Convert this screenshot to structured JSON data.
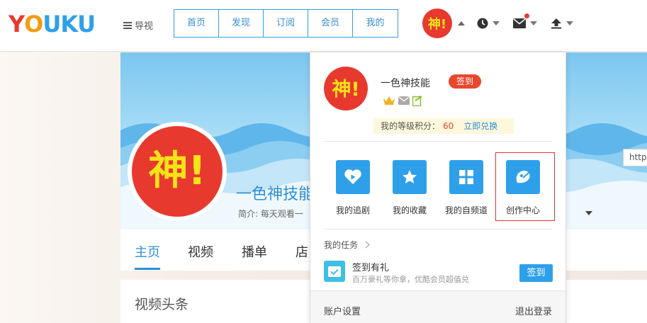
{
  "header": {
    "logo_letters": [
      "Y",
      "O",
      "U",
      "K",
      "U"
    ],
    "logo_colors": [
      "#e8392e",
      "#f39c12",
      "#2ea0ea",
      "#2ea0ea",
      "#2ea0ea"
    ],
    "guide_label": "导视",
    "tabs": [
      "首页",
      "发现",
      "订阅",
      "会员",
      "我的"
    ],
    "icons": [
      "history-clock-icon",
      "message-envelope-icon",
      "upload-icon"
    ]
  },
  "avatar_text": "神!",
  "profile": {
    "name": "一色神技能",
    "intro": "简介: 每天观看一",
    "tooltip": "http",
    "nav": [
      "主页",
      "视频",
      "播单",
      "店"
    ],
    "section_title": "视频头条"
  },
  "dropdown": {
    "username": "一色神技能",
    "checkin_label": "签到",
    "points_label": "我的等级积分：",
    "points_value": "60",
    "redeem_link": "立即兑换",
    "quick_links": [
      {
        "label": "我的追剧",
        "icon": "heart-play-icon"
      },
      {
        "label": "我的收藏",
        "icon": "star-icon"
      },
      {
        "label": "我的自频道",
        "icon": "grid-icon"
      },
      {
        "label": "创作中心",
        "icon": "creator-bird-icon"
      }
    ],
    "tasks_heading": "我的任务",
    "task": {
      "title": "签到有礼",
      "desc": "百万豪礼等你拿，优酷会员超值兑",
      "button": "签到"
    },
    "account_settings": "账户设置",
    "logout": "退出登录"
  },
  "colors": {
    "accent_blue": "#2ea0ea",
    "checkin_red": "#e8472d",
    "avatar_red": "#e8392e",
    "avatar_text_yellow": "#f5e31a"
  }
}
